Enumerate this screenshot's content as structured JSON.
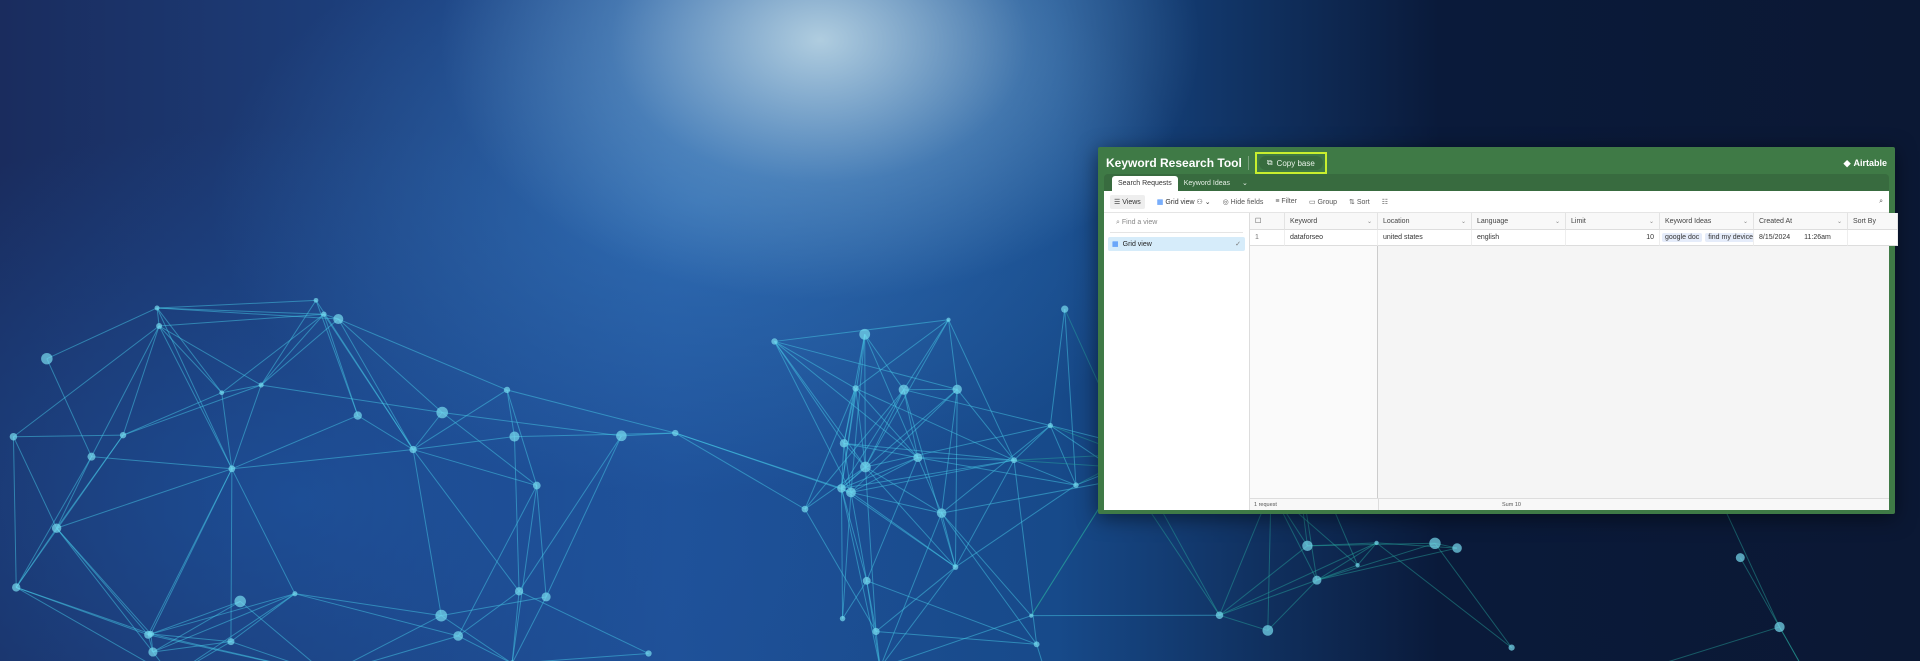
{
  "app": {
    "title": "Keyword Research Tool",
    "copy_label": "Copy base",
    "brand": "Airtable",
    "accent": "#3f7a46",
    "highlight": "#c8ef2e"
  },
  "tabs": [
    {
      "label": "Search Requests",
      "active": true
    },
    {
      "label": "Keyword Ideas",
      "active": false
    }
  ],
  "toolbar": {
    "views": "Views",
    "view_name": "Grid view",
    "hide_fields": "Hide fields",
    "filter": "Filter",
    "group": "Group",
    "sort": "Sort"
  },
  "sidebar": {
    "find_placeholder": "Find a view",
    "items": [
      {
        "label": "Grid view",
        "selected": true
      }
    ]
  },
  "table": {
    "columns": [
      "Keyword",
      "Location",
      "Language",
      "Limit",
      "Keyword Ideas",
      "Created At",
      "Sort By"
    ],
    "rows": [
      {
        "num": "1",
        "keyword": "dataforseo",
        "location": "united states",
        "language": "english",
        "limit": "10",
        "keyword_ideas": [
          "google doc",
          "find my device"
        ],
        "created_date": "8/15/2024",
        "created_time": "11:26am",
        "sort_by": ""
      }
    ],
    "footer_count": "1 request",
    "footer_sum": "Sum 10"
  }
}
